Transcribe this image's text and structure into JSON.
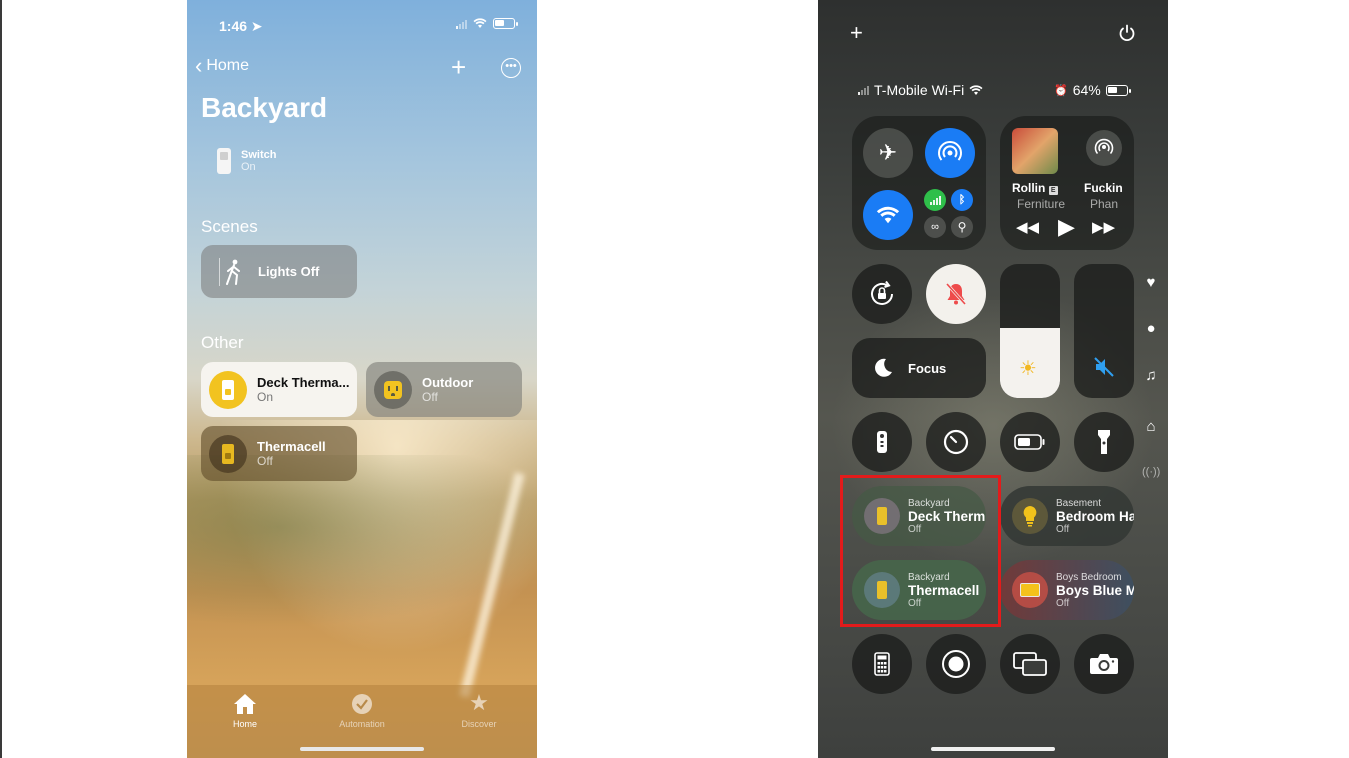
{
  "home_app": {
    "status_time": "1:46",
    "back_label": "Home",
    "title": "Backyard",
    "switch": {
      "name": "Switch",
      "state": "On"
    },
    "scenes_heading": "Scenes",
    "scene": {
      "label": "Lights Off"
    },
    "other_heading": "Other",
    "tiles": [
      {
        "name": "Deck Therma...",
        "state": "On"
      },
      {
        "name": "Outdoor",
        "state": "Off"
      },
      {
        "name": "Thermacell",
        "state": "Off"
      }
    ],
    "tabs": [
      {
        "label": "Home",
        "icon": "house-icon"
      },
      {
        "label": "Automation",
        "icon": "clock-check-icon"
      },
      {
        "label": "Discover",
        "icon": "star-icon"
      }
    ]
  },
  "control_center": {
    "carrier": "T-Mobile Wi-Fi",
    "battery": "64%",
    "now_playing": [
      {
        "title": "Rollin",
        "artist": "Ferniture"
      },
      {
        "title": "Fuckin",
        "artist": "Phan"
      }
    ],
    "focus_label": "Focus",
    "home_tiles": [
      {
        "room": "Backyard",
        "name": "Deck Therm",
        "state": "Off"
      },
      {
        "room": "Basement",
        "name": "Bedroom Ha",
        "state": "Off"
      },
      {
        "room": "Backyard",
        "name": "Thermacell",
        "state": "Off"
      },
      {
        "room": "Boys Bedroom",
        "name": "Boys Blue M",
        "state": "Off"
      }
    ],
    "highlight_color": "#e31b1b"
  }
}
